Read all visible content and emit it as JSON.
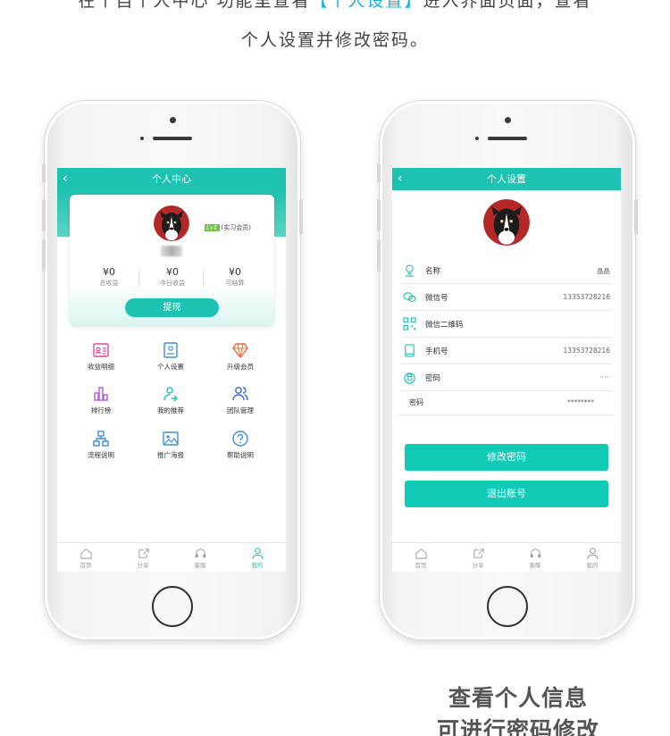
{
  "intro": {
    "line1_pre": "在个自个人中心 功能里查看",
    "line1_highlight": "【个人设置】",
    "line1_post": "进入界面页面，查看",
    "line2": "个人设置并修改密码。"
  },
  "left_screen": {
    "header_title": "个人中心",
    "level_badge": "Lv1",
    "member_level": "(实习会员)",
    "stats": [
      {
        "amount": "¥0",
        "label": "总收益"
      },
      {
        "amount": "¥0",
        "label": "今日收益"
      },
      {
        "amount": "¥0",
        "label": "可结算"
      }
    ],
    "withdraw_label": "提现",
    "grid": [
      {
        "icon": "income-detail-icon",
        "label": "收益明细",
        "color": "#e0479e"
      },
      {
        "icon": "personal-settings-icon",
        "label": "个人设置",
        "color": "#3d8be0"
      },
      {
        "icon": "upgrade-diamond-icon",
        "label": "升级会员",
        "color": "#f06a3a"
      },
      {
        "icon": "ranking-icon",
        "label": "排行榜",
        "color": "#b05ad8"
      },
      {
        "icon": "my-referrals-icon",
        "label": "我的推荐",
        "color": "#1ec2b0"
      },
      {
        "icon": "team-management-icon",
        "label": "团队管理",
        "color": "#3b66d8"
      },
      {
        "icon": "process-flow-icon",
        "label": "流程说明",
        "color": "#3d8be0"
      },
      {
        "icon": "poster-image-icon",
        "label": "推广海报",
        "color": "#3d8be0"
      },
      {
        "icon": "help-icon",
        "label": "帮助说明",
        "color": "#3d8be0"
      }
    ],
    "tabs": [
      {
        "icon": "home-icon",
        "label": "首页",
        "active": false
      },
      {
        "icon": "share-icon",
        "label": "分享",
        "active": false
      },
      {
        "icon": "headset-icon",
        "label": "客服",
        "active": false
      },
      {
        "icon": "profile-icon",
        "label": "我的",
        "active": true
      }
    ]
  },
  "right_screen": {
    "header_title": "个人设置",
    "rows": [
      {
        "icon": "user-avatar-icon",
        "label": "名称",
        "value": "晶晶"
      },
      {
        "icon": "wechat-icon",
        "label": "微信号",
        "value": "13353728216"
      },
      {
        "icon": "qr-code-icon",
        "label": "微信二维码",
        "value": ""
      },
      {
        "icon": "mobile-phone-icon",
        "label": "手机号",
        "value": "13353728216"
      },
      {
        "icon": "lock-icon",
        "label": "密码",
        "value": "·····"
      }
    ],
    "password_row": {
      "label": "密码",
      "value": "********"
    },
    "change_password_label": "修改密码",
    "logout_label": "退出账号",
    "tabs": [
      {
        "icon": "home-icon",
        "label": "首页"
      },
      {
        "icon": "share-icon",
        "label": "分享"
      },
      {
        "icon": "headset-icon",
        "label": "客服"
      },
      {
        "icon": "profile-icon",
        "label": "我的"
      }
    ]
  },
  "caption": {
    "line1": "查看个人信息",
    "line2": "可进行密码修改"
  },
  "colors": {
    "accent": "#1ec2b0",
    "button": "#12cbb6",
    "highlight": "#16b3e0"
  }
}
